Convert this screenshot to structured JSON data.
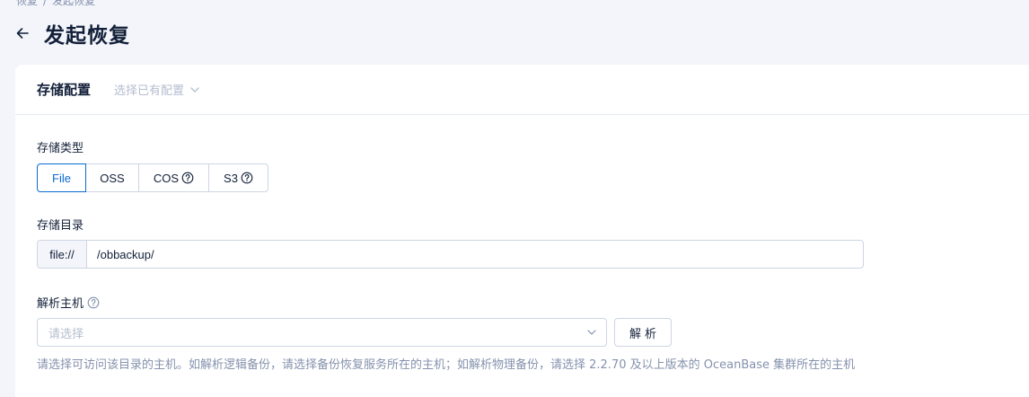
{
  "breadcrumb": [
    "恢复",
    "发起恢复"
  ],
  "breadcrumb_sep": "/",
  "page": {
    "title": "发起恢复"
  },
  "card": {
    "title": "存储配置",
    "config_select_placeholder": "选择已有配置"
  },
  "storage_type": {
    "label": "存储类型",
    "options": [
      {
        "label": "File",
        "selected": true,
        "help": false
      },
      {
        "label": "OSS",
        "selected": false,
        "help": false
      },
      {
        "label": "COS",
        "selected": false,
        "help": true
      },
      {
        "label": "S3",
        "selected": false,
        "help": true
      }
    ]
  },
  "storage_dir": {
    "label": "存储目录",
    "prefix": "file://",
    "value": "/obbackup/"
  },
  "parse_host": {
    "label": "解析主机",
    "placeholder": "请选择",
    "button_label": "解析",
    "hint": "请选择可访问该目录的主机。如解析逻辑备份，请选择备份恢复服务所在的主机；如解析物理备份，请选择 2.2.70 及以上版本的 OceanBase 集群所在的主机"
  },
  "colors": {
    "primary": "#0b6bd4",
    "background": "#f3f5fa",
    "text": "#132039",
    "muted": "#8592ad",
    "border": "#cdd5e4"
  }
}
